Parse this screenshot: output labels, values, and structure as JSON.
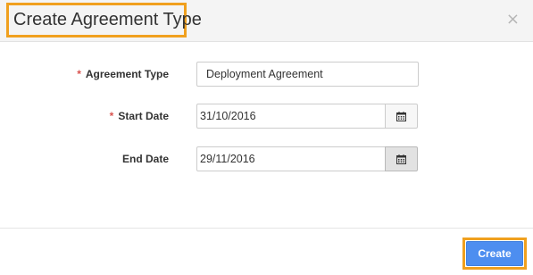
{
  "dialog": {
    "title": "Create Agreement Type",
    "close_glyph": "×"
  },
  "form": {
    "agreement_type": {
      "required_marker": "*",
      "label": "Agreement Type",
      "value": "Deployment Agreement"
    },
    "start_date": {
      "required_marker": "*",
      "label": "Start Date",
      "value": "31/10/2016",
      "icon": "calendar-icon"
    },
    "end_date": {
      "label": "End Date",
      "value": "29/11/2016",
      "icon": "calendar-icon"
    }
  },
  "footer": {
    "create_label": "Create"
  },
  "colors": {
    "highlight": "#f0a01e",
    "primary": "#4d8ef0",
    "required": "#d9534f"
  }
}
